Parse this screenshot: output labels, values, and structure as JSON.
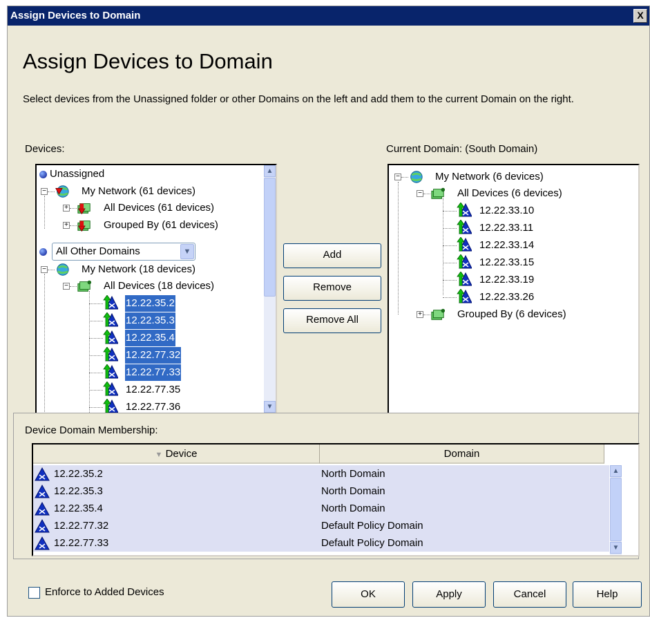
{
  "window": {
    "title": "Assign Devices to Domain",
    "close_label": "X"
  },
  "heading": "Assign Devices to Domain",
  "description": "Select devices from the Unassigned folder or other Domains on the left and add them to the current Domain on the right.",
  "devices": {
    "label": "Devices:",
    "unassigned": "Unassigned",
    "my_network_1": "My Network (61 devices)",
    "all_devices_1": "All Devices (61 devices)",
    "grouped_1": "Grouped By (61 devices)",
    "domain_select": "All Other Domains",
    "my_network_2": "My Network (18 devices)",
    "all_devices_2": "All Devices (18 devices)",
    "items": [
      "12.22.35.2",
      "12.22.35.3",
      "12.22.35.4",
      "12.22.77.32",
      "12.22.77.33",
      "12.22.77.35",
      "12.22.77.36"
    ]
  },
  "buttons": {
    "add": "Add",
    "remove": "Remove",
    "remove_all": "Remove All",
    "ok": "OK",
    "apply": "Apply",
    "cancel": "Cancel",
    "help": "Help"
  },
  "current_domain": {
    "label": "Current Domain: (South Domain)",
    "my_network": "My Network (6 devices)",
    "all_devices": "All Devices (6 devices)",
    "items": [
      "12.22.33.10",
      "12.22.33.11",
      "12.22.33.14",
      "12.22.33.15",
      "12.22.33.19",
      "12.22.33.26"
    ],
    "grouped": "Grouped By (6 devices)"
  },
  "membership": {
    "label": "Device Domain Membership:",
    "columns": [
      "Device",
      "Domain"
    ],
    "rows": [
      {
        "device": "12.22.35.2",
        "domain": "North Domain"
      },
      {
        "device": "12.22.35.3",
        "domain": "North Domain"
      },
      {
        "device": "12.22.35.4",
        "domain": "North Domain"
      },
      {
        "device": "12.22.77.32",
        "domain": "Default Policy Domain"
      },
      {
        "device": "12.22.77.33",
        "domain": "Default Policy Domain"
      }
    ]
  },
  "enforce_label": "Enforce to Added Devices",
  "colors": {
    "selection": "#316ac5",
    "titlebar": "#08246b",
    "dialog": "#ece9d8"
  }
}
